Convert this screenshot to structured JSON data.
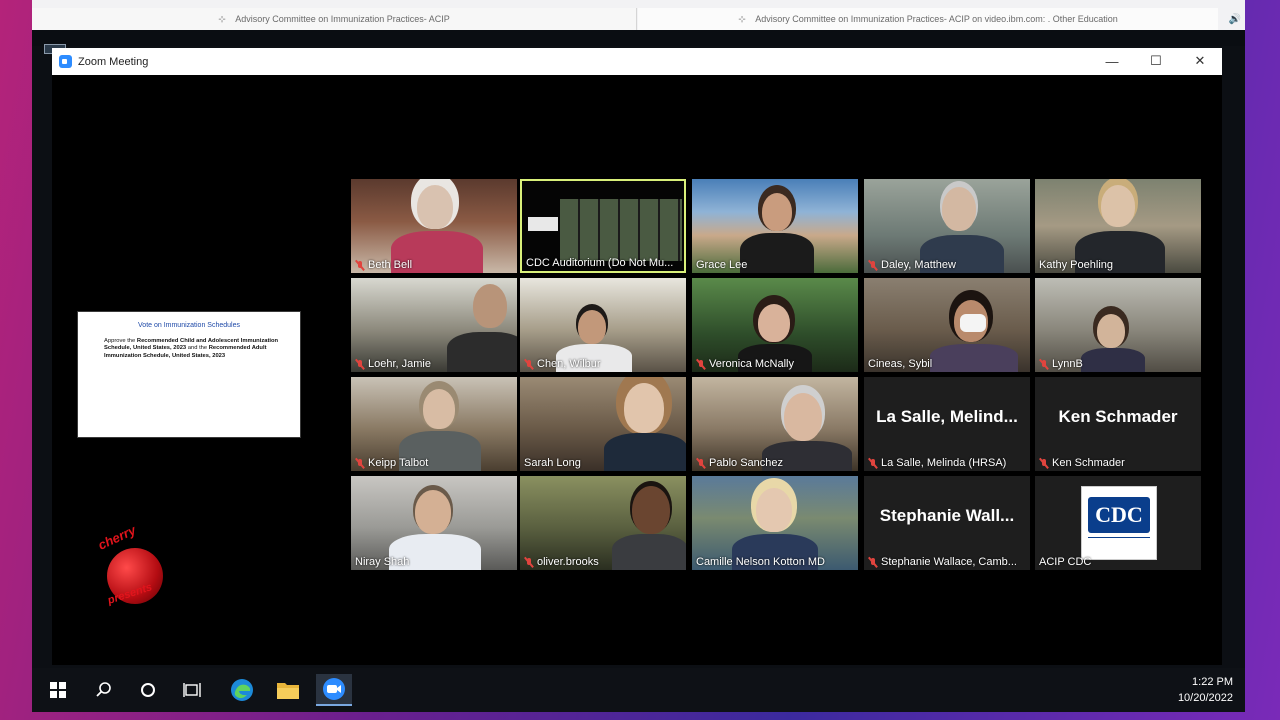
{
  "browser": {
    "tabs": [
      {
        "label": "Advisory Committee on Immunization Practices- ACIP"
      },
      {
        "label": "Advisory Committee on Immunization Practices- ACIP on video.ibm.com: . Other Education"
      }
    ]
  },
  "zoom": {
    "title": "Zoom Meeting",
    "window_controls": {
      "minimize": "—",
      "maximize": "☐",
      "close": "✕"
    }
  },
  "shared_slide": {
    "title": "Vote on Immunization Schedules",
    "lines": [
      "Approve the",
      "Recommended Child and Adolescent Immunization Schedule, United States, 2023",
      "and the",
      "Recommended Adult Immunization Schedule, United States, 2023"
    ]
  },
  "watermark": {
    "top": "cherry",
    "bottom": "presents"
  },
  "participants": [
    {
      "name": "Beth Bell",
      "muted": true
    },
    {
      "name": "CDC Auditorium (Do Not Mu...",
      "muted": false,
      "active": true
    },
    {
      "name": "Grace Lee",
      "muted": false
    },
    {
      "name": "Daley, Matthew",
      "muted": true
    },
    {
      "name": "Kathy Poehling",
      "muted": false
    },
    {
      "name": "Loehr, Jamie",
      "muted": true
    },
    {
      "name": "Chen, Wilbur",
      "muted": true
    },
    {
      "name": "Veronica McNally",
      "muted": true
    },
    {
      "name": "Cineas, Sybil",
      "muted": false
    },
    {
      "name": "LynnB",
      "muted": true
    },
    {
      "name": "Keipp Talbot",
      "muted": true
    },
    {
      "name": "Sarah Long",
      "muted": false
    },
    {
      "name": "Pablo Sanchez",
      "muted": true
    },
    {
      "name": "La Salle, Melinda (HRSA)",
      "muted": true,
      "display_name": "La Salle, Melind..."
    },
    {
      "name": "Ken Schmader",
      "muted": true,
      "display_name": "Ken Schmader"
    },
    {
      "name": "Niray Shah",
      "muted": false
    },
    {
      "name": "oliver.brooks",
      "muted": true
    },
    {
      "name": "Camille Nelson Kotton MD",
      "muted": false
    },
    {
      "name": "Stephanie Wallace, Camb...",
      "muted": true,
      "display_name": "Stephanie Wall..."
    },
    {
      "name": "ACIP CDC",
      "muted": false,
      "logo_text": "CDC"
    }
  ],
  "taskbar": {
    "icons": [
      "windows-start-icon",
      "search-icon",
      "cortana-icon",
      "task-view-icon",
      "edge-icon",
      "file-explorer-icon",
      "zoom-icon"
    ],
    "time": "1:22 PM",
    "date": "10/20/2022"
  }
}
